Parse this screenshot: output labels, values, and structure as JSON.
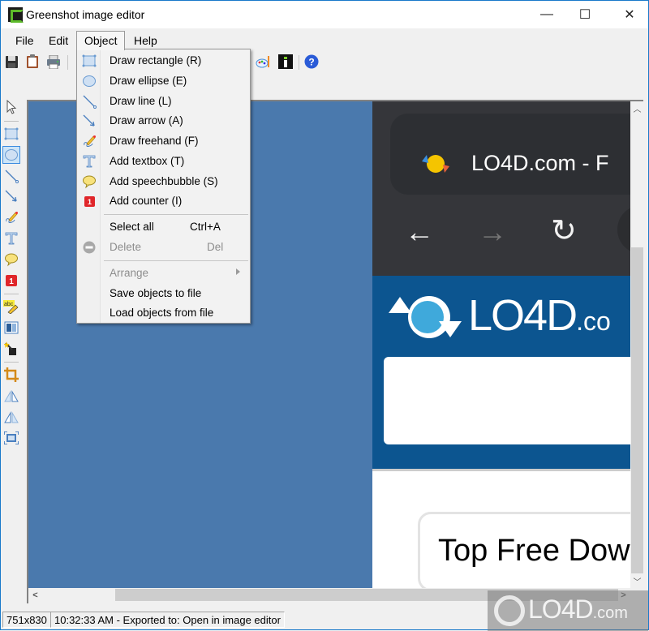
{
  "window": {
    "title": "Greenshot image editor",
    "controls": {
      "minimize": "—",
      "maximize": "☐",
      "close": "✕"
    }
  },
  "menubar": {
    "items": [
      {
        "label": "File"
      },
      {
        "label": "Edit"
      },
      {
        "label": "Object",
        "open": true
      },
      {
        "label": "Help"
      }
    ]
  },
  "toolbar": {
    "icons": [
      "save-icon",
      "clipboard-icon",
      "print-icon",
      "palette-icon",
      "info-icon",
      "help-icon"
    ]
  },
  "object_menu": {
    "items": [
      {
        "label": "Draw rectangle (R)",
        "icon": "rectangle-icon",
        "enabled": true
      },
      {
        "label": "Draw ellipse (E)",
        "icon": "ellipse-icon",
        "enabled": true
      },
      {
        "label": "Draw line (L)",
        "icon": "line-icon",
        "enabled": true
      },
      {
        "label": "Draw arrow (A)",
        "icon": "arrow-icon",
        "enabled": true
      },
      {
        "label": "Draw freehand (F)",
        "icon": "freehand-icon",
        "enabled": true
      },
      {
        "label": "Add textbox (T)",
        "icon": "textbox-icon",
        "enabled": true
      },
      {
        "label": "Add speechbubble (S)",
        "icon": "speechbubble-icon",
        "enabled": true
      },
      {
        "label": "Add counter (I)",
        "icon": "counter-icon",
        "enabled": true
      },
      {
        "label": "Select all",
        "shortcut": "Ctrl+A",
        "enabled": true
      },
      {
        "label": "Delete",
        "shortcut": "Del",
        "icon": "delete-icon",
        "enabled": false
      },
      {
        "label": "Arrange",
        "submenu": true,
        "enabled": false
      },
      {
        "label": "Save objects to file",
        "enabled": true
      },
      {
        "label": "Load objects from file",
        "enabled": true
      }
    ]
  },
  "tools": {
    "items": [
      "select",
      "rectangle",
      "ellipse",
      "line",
      "arrow",
      "freehand",
      "textbox",
      "speechbubble",
      "counter",
      "highlight",
      "obfuscate",
      "effects",
      "crop",
      "rotate-clockwise",
      "rotate-counterclockwise",
      "resize"
    ],
    "active": "ellipse"
  },
  "canvas": {
    "browser_tab_title": "LO4D.com - F",
    "site_logo": "LO4D",
    "site_logo_suffix": ".co",
    "card_text": "Top Free Dow"
  },
  "statusbar": {
    "dimensions": "751x830",
    "message": "10:32:33 AM - Exported to: Open in image editor"
  },
  "watermark": {
    "text": "LO4D",
    "suffix": ".com"
  },
  "colors": {
    "canvas_bg": "#4a79ad",
    "site_header": "#0c5590",
    "browser_chrome": "#35363a",
    "window_border": "#1979ca"
  }
}
